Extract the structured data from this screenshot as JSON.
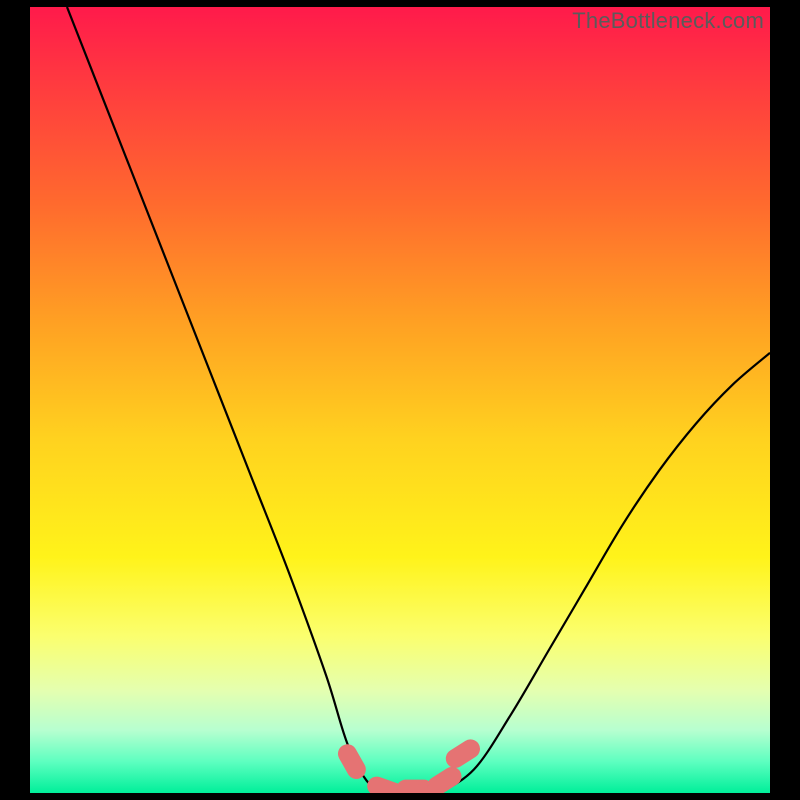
{
  "watermark": {
    "text": "TheBottleneck.com"
  },
  "colors": {
    "curve_stroke": "#000000",
    "marker_fill": "#e57373",
    "marker_stroke": "#e57373"
  },
  "chart_data": {
    "type": "line",
    "title": "",
    "xlabel": "",
    "ylabel": "",
    "xlim": [
      0,
      100
    ],
    "ylim": [
      0,
      100
    ],
    "series": [
      {
        "name": "bottleneck-curve",
        "x": [
          5,
          10,
          15,
          20,
          25,
          30,
          35,
          40,
          43,
          46,
          49,
          52,
          55,
          60,
          65,
          70,
          75,
          80,
          85,
          90,
          95,
          100
        ],
        "y": [
          100,
          88,
          76,
          64,
          52,
          40,
          28,
          15,
          6,
          1,
          0,
          0,
          0,
          3,
          10,
          18,
          26,
          34,
          41,
          47,
          52,
          56
        ]
      }
    ],
    "markers": [
      {
        "x": 43.5,
        "y": 4.0
      },
      {
        "x": 48.0,
        "y": 0.5
      },
      {
        "x": 52.0,
        "y": 0.5
      },
      {
        "x": 56.0,
        "y": 1.5
      },
      {
        "x": 58.5,
        "y": 5.0
      }
    ],
    "marker_style": {
      "shape": "capsule",
      "radius": 9,
      "length": 36
    }
  }
}
